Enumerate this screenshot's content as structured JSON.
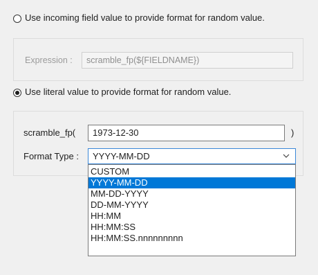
{
  "mode_options": {
    "incoming_label": "Use incoming field value to provide format for random value.",
    "incoming_selected": false,
    "literal_label": "Use literal value to provide format for random value.",
    "literal_selected": true
  },
  "expression": {
    "label": "Expression :",
    "value": "scramble_fp(${FIELDNAME})"
  },
  "literal": {
    "func_label": "scramble_fp(",
    "value": "1973-12-30",
    "close_paren": ")",
    "format_label": "Format Type :",
    "format_value": "YYYY-MM-DD",
    "format_options": [
      "CUSTOM",
      "YYYY-MM-DD",
      "MM-DD-YYYY",
      "DD-MM-YYYY",
      "HH:MM",
      "HH:MM:SS",
      "HH:MM:SS.nnnnnnnnn"
    ],
    "selected_index": 1
  },
  "icons": {
    "chevron": "chevron-down-icon",
    "radio_off": "radio-unchecked-icon",
    "radio_on": "radio-checked-icon"
  },
  "colors": {
    "selection": "#0078d7",
    "focus_border": "#3a87d8"
  }
}
